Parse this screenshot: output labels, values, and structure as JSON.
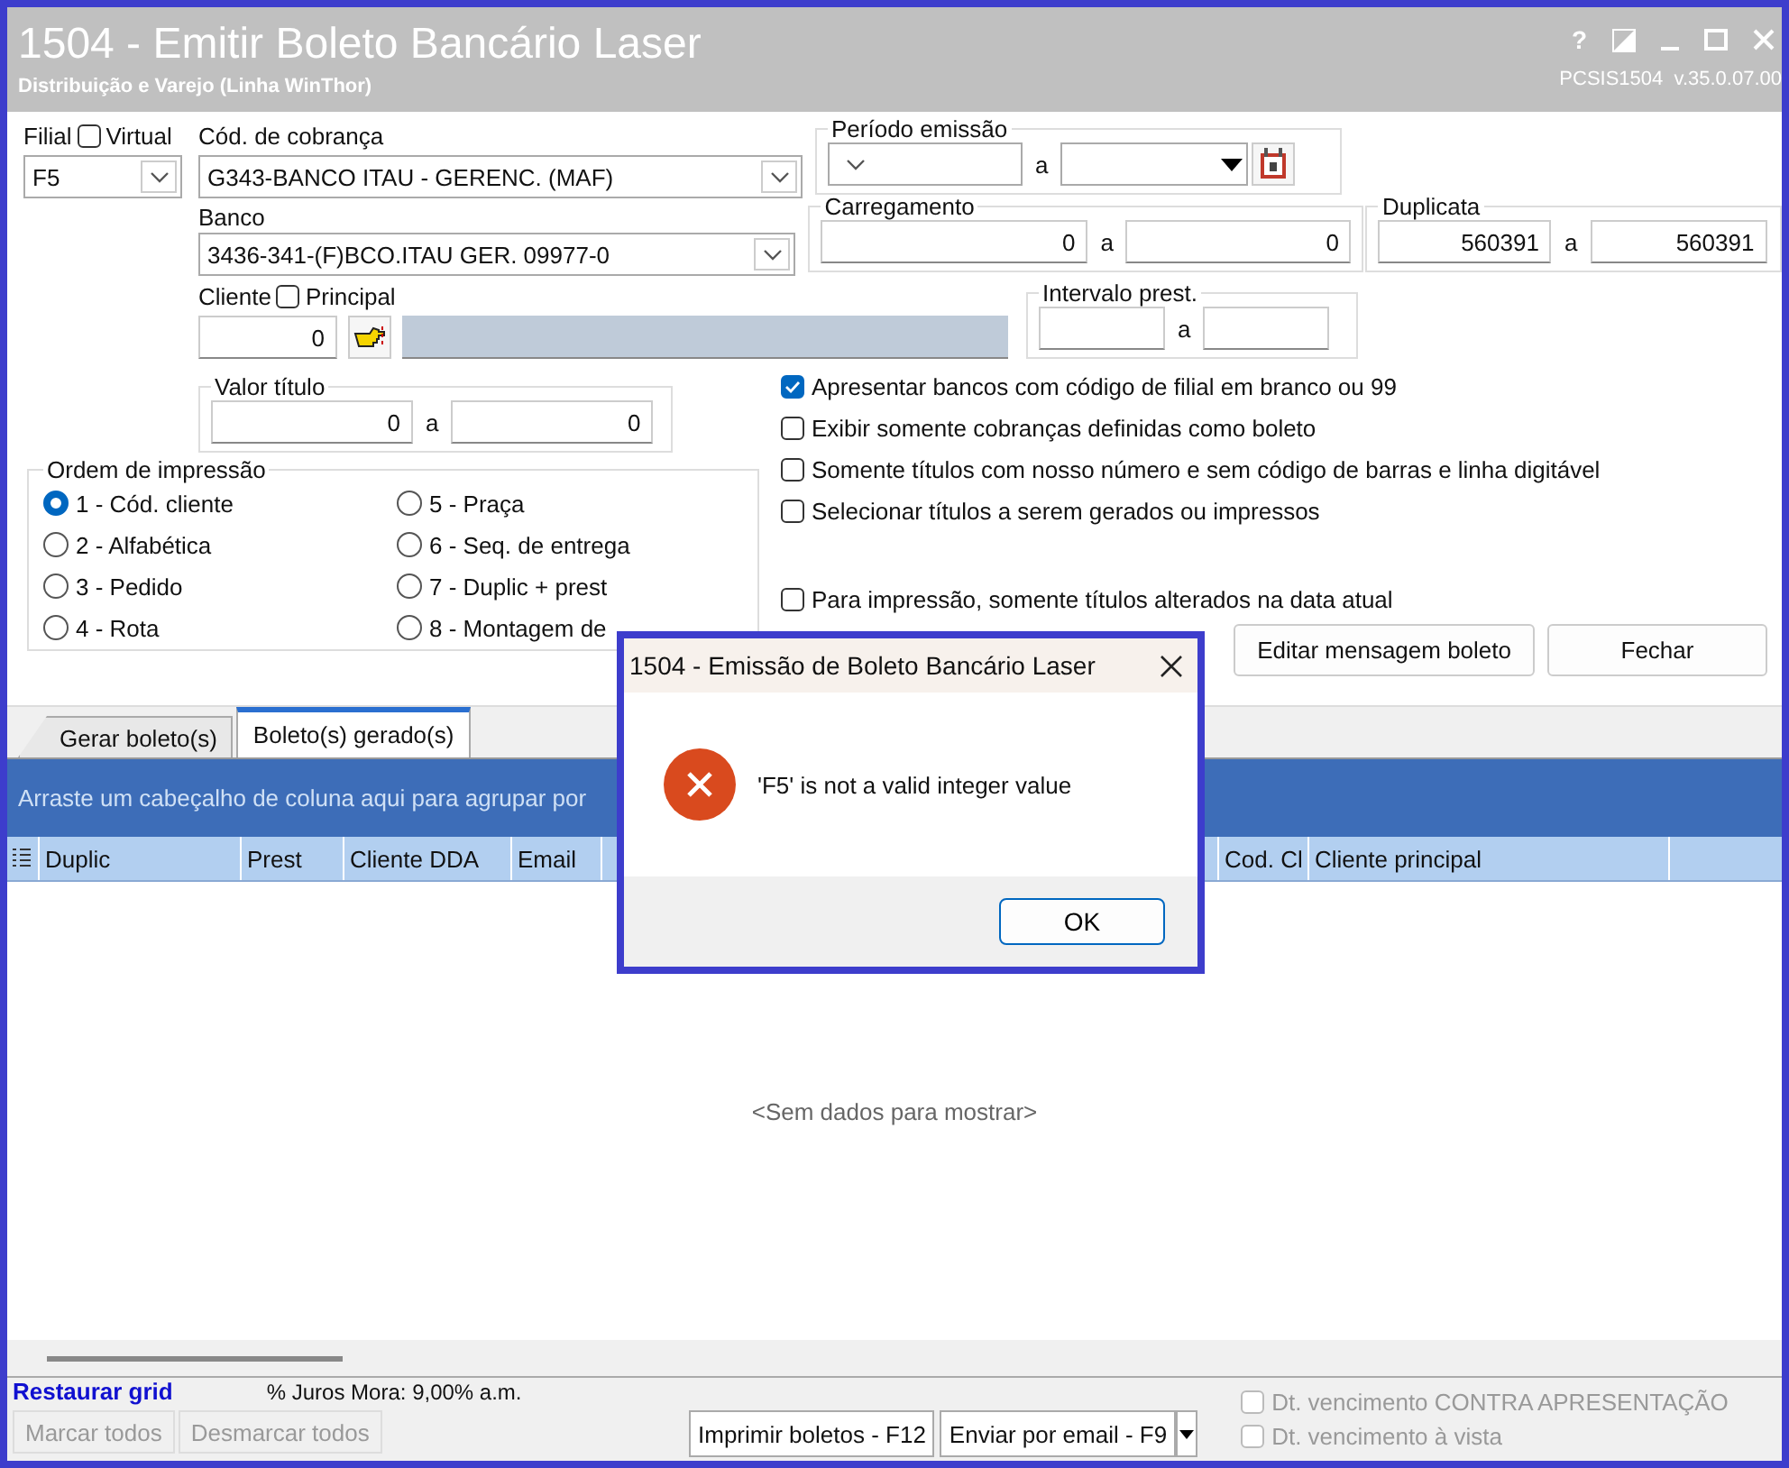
{
  "window": {
    "title": "1504 - Emitir Boleto Bancário Laser",
    "subtitle": "Distribuição e Varejo (Linha WinThor)",
    "help": "?",
    "version": "PCSIS1504  v.35.0.07.00"
  },
  "filial": {
    "label": "Filial",
    "virtual": {
      "label": "Virtual",
      "checked": false
    },
    "value": "F5"
  },
  "cod_cobranca": {
    "label": "Cód. de cobrança",
    "value": "G343-BANCO ITAU - GERENC. (MAF)"
  },
  "periodo_emissao": {
    "label": "Período emissão",
    "sep": "a"
  },
  "banco": {
    "label": "Banco",
    "value": "3436-341-(F)BCO.ITAU GER. 09977-0"
  },
  "carregamento": {
    "label": "Carregamento",
    "from": "0",
    "sep": "a",
    "to": "0"
  },
  "duplicata": {
    "label": "Duplicata",
    "from": "560391",
    "sep": "a",
    "to": "560391"
  },
  "cliente": {
    "label": "Cliente",
    "principal": {
      "label": "Principal",
      "checked": false
    },
    "value": "0"
  },
  "intervalo_prest": {
    "label": "Intervalo prest.",
    "sep": "a"
  },
  "valor_titulo": {
    "label": "Valor título",
    "from": "0",
    "sep": "a",
    "to": "0"
  },
  "options": [
    {
      "label": "Apresentar bancos com código de filial em branco ou 99",
      "checked": true
    },
    {
      "label": "Exibir somente cobranças definidas como boleto",
      "checked": false
    },
    {
      "label": "Somente títulos com nosso número e sem código de barras e linha digitável",
      "checked": false
    },
    {
      "label": "Selecionar títulos a serem gerados ou impressos",
      "checked": false
    }
  ],
  "para_impressao": {
    "label": "Para impressão, somente títulos alterados na data atual",
    "checked": false
  },
  "ordem": {
    "label": "Ordem de impressão",
    "options": [
      {
        "label": "1 - Cód. cliente",
        "selected": true
      },
      {
        "label": "2 - Alfabética",
        "selected": false
      },
      {
        "label": "3 - Pedido",
        "selected": false
      },
      {
        "label": "4 - Rota",
        "selected": false
      },
      {
        "label": "5 - Praça",
        "selected": false
      },
      {
        "label": "6 - Seq. de entrega",
        "selected": false
      },
      {
        "label": "7 - Duplic + prest",
        "selected": false
      },
      {
        "label": "8 - Montagem de",
        "selected": false
      }
    ]
  },
  "buttons": [
    "Editar mensagem boleto",
    "Fechar"
  ],
  "tabs": [
    {
      "label": "Gerar boleto(s)",
      "selected": false
    },
    {
      "label": "Boleto(s) gerado(s)",
      "selected": true
    }
  ],
  "group_panel": "Arraste um cabeçalho de coluna aqui para agrupar por",
  "grid": {
    "columns": [
      "Duplic",
      "Prest",
      "Cliente DDA",
      "Email",
      "Cod. Cl",
      "Cliente principal"
    ],
    "empty": "<Sem dados para mostrar>"
  },
  "bottom": {
    "restore": "Restaurar grid",
    "juros": "% Juros Mora: 9,00% a.m.",
    "select_buttons": [
      {
        "label": "Marcar todos",
        "disabled": true
      },
      {
        "label": "Desmarcar todos",
        "disabled": true
      }
    ],
    "print": "Imprimir boletos - F12",
    "email": "Enviar por email - F9",
    "checks": [
      {
        "label": "Dt. vencimento CONTRA APRESENTAÇÃO",
        "checked": false,
        "disabled": true
      },
      {
        "label": "Dt. vencimento à vista",
        "checked": false,
        "disabled": true
      }
    ]
  },
  "dialog": {
    "title": "1504 - Emissão de Boleto Bancário Laser",
    "message": "'F5' is not a valid integer value",
    "ok": "OK"
  }
}
